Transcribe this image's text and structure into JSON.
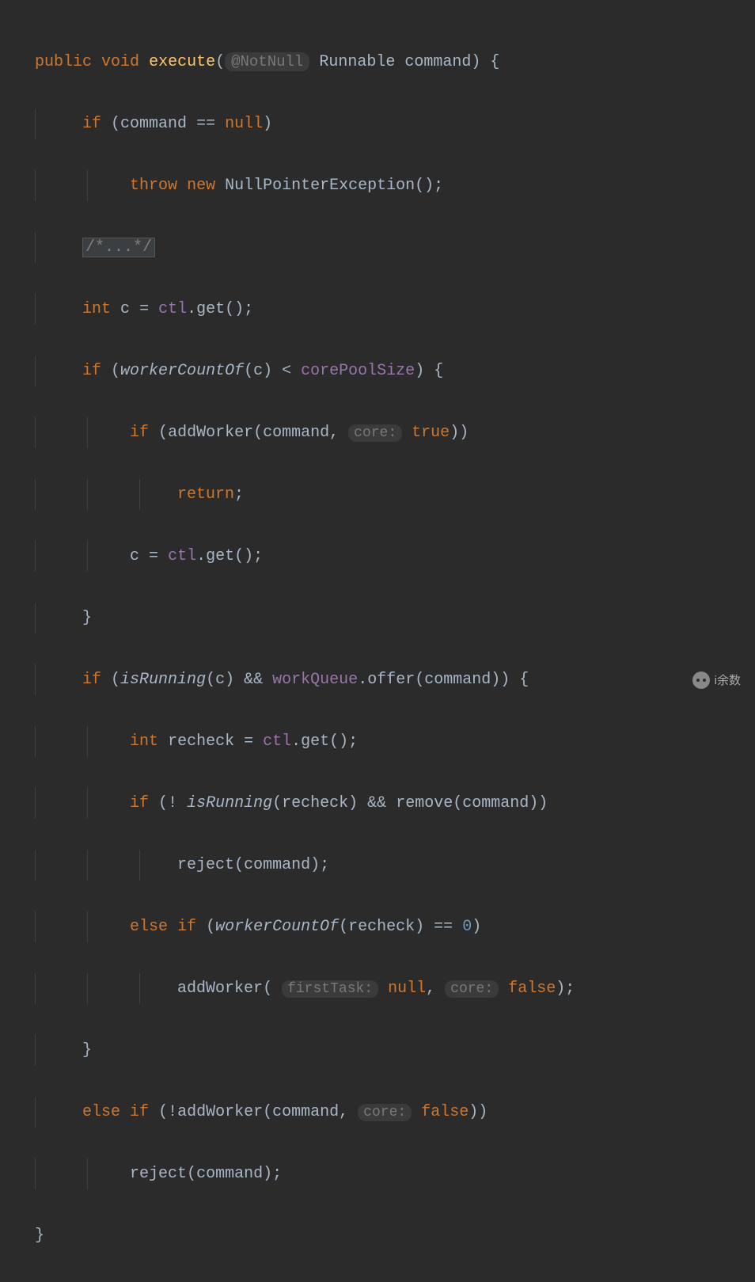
{
  "code": {
    "tokens": {
      "public": "public",
      "void": "void",
      "execute": "execute",
      "notnull": "@NotNull",
      "runnable": "Runnable",
      "command": "command",
      "if": "if",
      "eqeq": "==",
      "null": "null",
      "throw": "throw",
      "new": "new",
      "npe": "NullPointerException",
      "folded": "/*...*/",
      "int": "int",
      "c": "c",
      "ctl": "ctl",
      "get": "get",
      "workerCountOf": "workerCountOf",
      "lt": "<",
      "corePoolSize": "corePoolSize",
      "addWorker": "addWorker",
      "coreHint": "core:",
      "true": "true",
      "return": "return",
      "isRunning": "isRunning",
      "andand": "&&",
      "workQueue": "workQueue",
      "offer": "offer",
      "recheck": "recheck",
      "not": "!",
      "remove": "remove",
      "reject": "reject",
      "else": "else",
      "zero": "0",
      "firstTaskHint": "firstTask:",
      "false": "false"
    }
  },
  "watermark": "i余数"
}
